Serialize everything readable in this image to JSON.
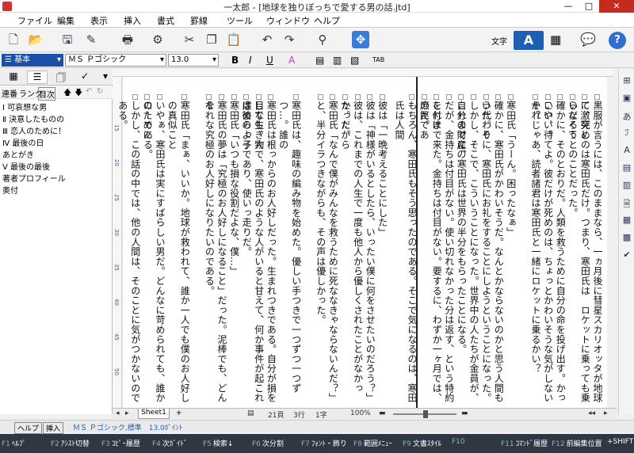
{
  "window": {
    "title": "一太郎 - [地球を独りぼっちで愛する男の話.jtd]",
    "min": "—",
    "max": "□",
    "close": "✕"
  },
  "menu": [
    "ファイル",
    "編集",
    "表示",
    "挿入",
    "書式",
    "罫線",
    "ツール",
    "ウィンドウ",
    "ヘルプ"
  ],
  "toolbar": {
    "mode_label": "文字",
    "mode_a": "A",
    "help": "?"
  },
  "format": {
    "style": "基本",
    "font": "ＭＳ Ｐゴシック",
    "size": "13.0",
    "bold": "B",
    "italic": "I",
    "underline": "U",
    "color_a": "A",
    "tab": "TAB"
  },
  "sidebar": {
    "tabs": [
      "連番",
      "ランク",
      "目次"
    ],
    "outline": [
      "Ⅰ 可哀想な男",
      "Ⅱ 決意したものの",
      "Ⅲ 恋人のために！",
      "Ⅳ 最後の日",
      "あとがき",
      "Ⅴ 最後の最後",
      "著者プロフィール",
      "奥付"
    ]
  },
  "document": {
    "columns": [
      "黒服が言うには、このままなら、一ヵ月後に彗星スカリオッタが地球に激突し",
      "て、死めのは寒田氏だけ。つまり、寒田氏は　ロケットに乗っても乗らなくて",
      "いだろうとのことだった。",
      "確かに、そのとおりだ。人類を救うために自分の命を投げ出す。かっこいい。",
      "いや、待てよ。彼だけが死めのは、ちょっとかわいそうな気がしないか？",
      "それじゃあ、読者諸君は寒田氏と一緒にロケットに乗るかい？",
      "",
      "寒田氏「うーん。困ったなぁ」",
      "確かに、寒田氏がかわいそうだ。なんとかならないのかと思う人間もいた。そ",
      "う代わりに、寒田氏にお礼をすることにしようということになった。",
      "しかし、そこで、こういうことになった。世界中の人たちが金員が、自分の財産の",
      "これまでに、寒田氏は世界の半分をもらったことになる。",
      "だが、金持ちは付目がない。使い切れなかった分は返す、という特約を付け",
      "これまで来た。金持ちは付目がない。要するに、わずか一ヶ月では、庶民であ",
      "のだ。",
      "もちろん、寒田氏もそう思ったのである。そこで気になるのは、寒田氏は人間",
      "",
      "彼は「一晩考えることにした」",
      "彼は「神様がいるとしたら、いったい僕に何をさせたいのだろう？」",
      "彼は、これまでの人生で一度も他人から優しくされたことがなかった。だから",
      "かった。",
      "寒田氏「なんで僕がみんなを救うために死ななきゃならないんだ？」",
      "と、半分イラつきながらも、その声は優しかった。",
      "",
      "寒田氏は、趣味の編み物を始めた。優しい手つきで一つずつ一つずつ…。誰の",
      "",
      "寒田氏は根っからのお人好しだった。生まれつきである。自分が損をしても、人",
      "目な生き物で、寒田氏のような人がいると甘えて、何か事件が起これは彼のよう",
      "虐めらっ子であり、使いっ走りだ。",
      "寒田氏「いつも損な役割だよな、僕…」",
      "寒田氏の夢は「究極のお人好しになること」だった。泥棒でも、どんな",
      "それな究極のお人好しになりたいのである。",
      "",
      "寒田氏「まぁ、いいか。地球が救われて、誰か一人でも僕のお人好しの真似こと",
      "",
      "いやぁ、寒田氏は実にすばらしい男だ。どんなに苛められても、誰かのために",
      "ローである。",
      "しかし、この話の中では、他の人間は、そのことに気がつかないのである。"
    ]
  },
  "scroll": {
    "sheet": "Sheet1",
    "line": "21頁",
    "row": "3行",
    "char": "1字",
    "zoom": "100%"
  },
  "status": {
    "help": "ヘルプ",
    "insert": "挿入",
    "font": "ＭＳ Ｐゴシック,標準　13.0ﾎﾟｲﾝﾄ"
  },
  "fkeys": [
    [
      "F1",
      "ﾍﾙﾌﾟ"
    ],
    [
      "F2",
      "ｱｼｽﾄ切替"
    ],
    [
      "F3",
      "ｺﾋﾟｰ履歴"
    ],
    [
      "F4",
      "次ｶﾞｲﾄﾞ"
    ],
    [
      "F5",
      "検索↓"
    ],
    [
      "F6",
      "次分割"
    ],
    [
      "F7",
      "ﾌｫﾝﾄ・飾り"
    ],
    [
      "F8",
      "範囲ﾒﾆｭｰ"
    ],
    [
      "F9",
      "文書ｽﾀｲﾙ"
    ],
    [
      "F10",
      ""
    ],
    [
      "F11",
      "ｺﾏﾝﾄﾞ履歴"
    ],
    [
      "F12",
      "前編集位置"
    ],
    [
      "",
      "+SHIFT"
    ]
  ]
}
